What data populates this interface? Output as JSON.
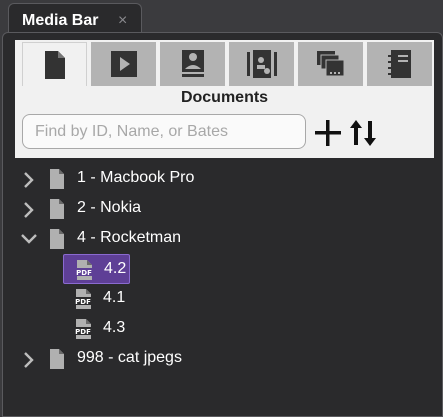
{
  "window_tab": {
    "title": "Media Bar",
    "close_glyph": "×"
  },
  "icon_tabs": [
    {
      "icon": "document-icon",
      "active": true
    },
    {
      "icon": "video-play-icon",
      "active": false
    },
    {
      "icon": "witness-card-icon",
      "active": false
    },
    {
      "icon": "exhibit-icon",
      "active": false
    },
    {
      "icon": "stacked-windows-icon",
      "active": false
    },
    {
      "icon": "notebook-icon",
      "active": false
    }
  ],
  "header": {
    "title": "Documents"
  },
  "search": {
    "placeholder": "Find by ID, Name, or Bates",
    "value": ""
  },
  "actions": {
    "add_icon": "plus-icon",
    "sort_icon": "sort-updown-icon"
  },
  "tree": [
    {
      "label": "1 - Macbook Pro",
      "expanded": false,
      "children": []
    },
    {
      "label": "2 - Nokia",
      "expanded": false,
      "children": []
    },
    {
      "label": "4 - Rocketman",
      "expanded": true,
      "children": [
        {
          "label": "4.2",
          "type": "PDF",
          "selected": true
        },
        {
          "label": "4.1",
          "type": "PDF",
          "selected": false
        },
        {
          "label": "4.3",
          "type": "PDF",
          "selected": false
        }
      ]
    },
    {
      "label": "998 - cat jpegs",
      "expanded": false,
      "children": []
    }
  ],
  "colors": {
    "background": "#3b3b3e",
    "panel": "#2a2a2c",
    "selection": "#5e3f96",
    "header": "#f1f1f1"
  }
}
